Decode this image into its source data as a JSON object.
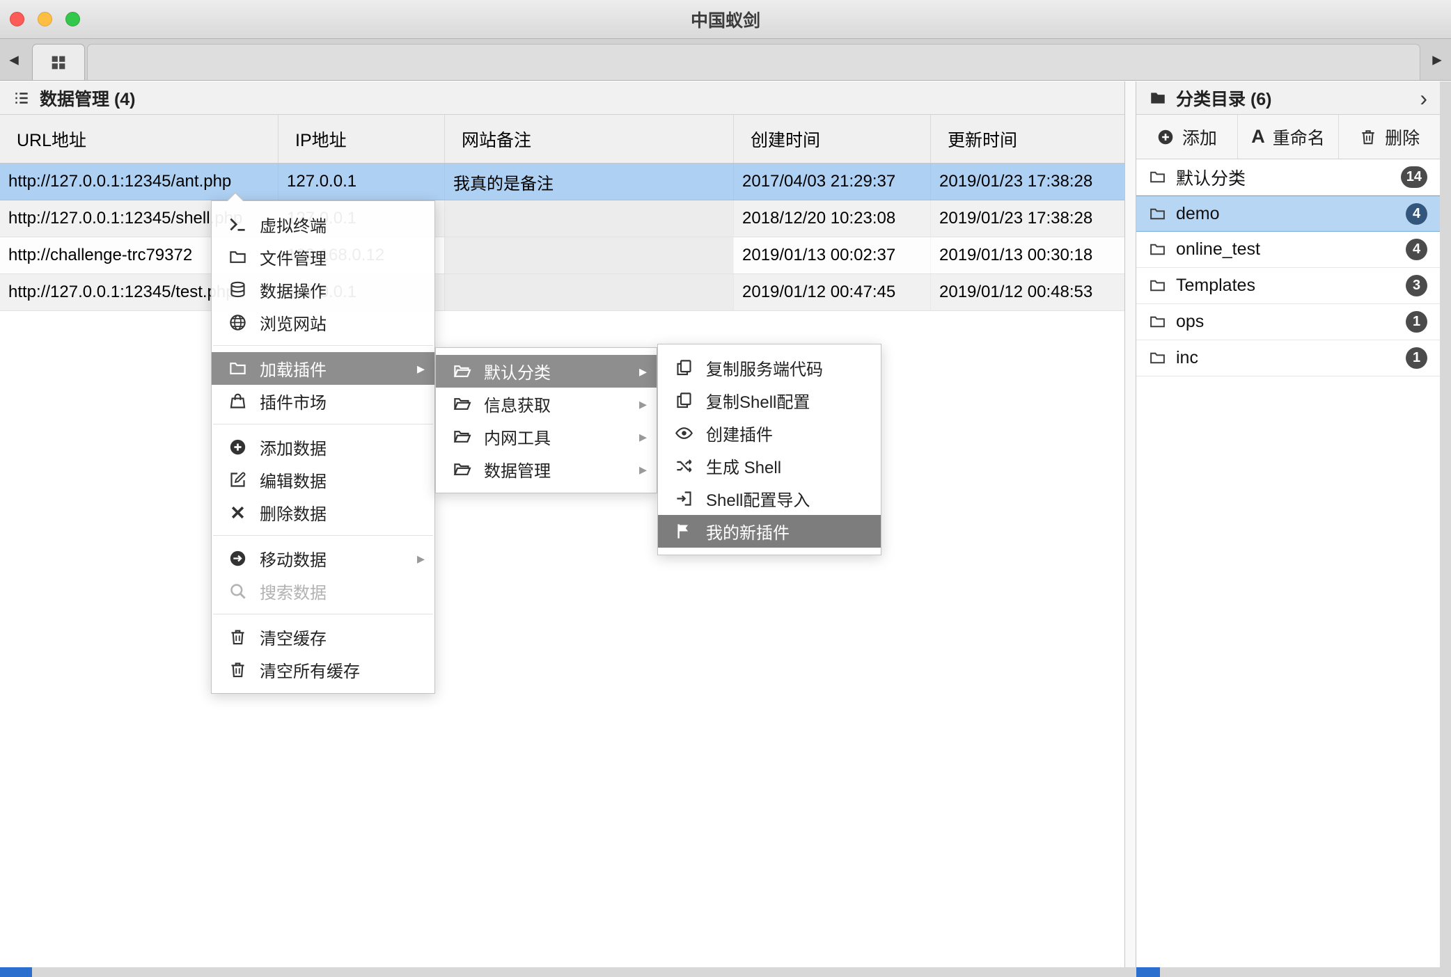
{
  "window": {
    "title": "中国蚁剑"
  },
  "glyphs": {
    "submenu_arrow": "▸",
    "tab_left_arrow": "◂",
    "tab_right_arrow": "▸",
    "panel_chevron": "›",
    "rename_letter": "A"
  },
  "data_panel": {
    "header": {
      "icon": "list-icon",
      "title": "数据管理 (4)"
    },
    "table": {
      "columns": [
        "URL地址",
        "IP地址",
        "网站备注",
        "创建时间",
        "更新时间"
      ],
      "rows": [
        {
          "url": "http://127.0.0.1:12345/ant.php",
          "ip": "127.0.0.1",
          "note": "我真的是备注",
          "created": "2017/04/03 21:29:37",
          "updated": "2019/01/23 17:38:28",
          "selected": true
        },
        {
          "url": "http://127.0.0.1:12345/shell.php",
          "ip": "127.0.0.1",
          "note": "",
          "created": "2018/12/20 10:23:08",
          "updated": "2019/01/23 17:38:28",
          "selected": false
        },
        {
          "url": "http://challenge-trc79372",
          "ip": "192.168.0.12",
          "note": "",
          "created": "2019/01/13 00:02:37",
          "updated": "2019/01/13 00:30:18",
          "selected": false
        },
        {
          "url": "http://127.0.0.1:12345/test.php",
          "ip": "127.0.0.1",
          "note": "",
          "created": "2019/01/12 00:47:45",
          "updated": "2019/01/12 00:48:53",
          "selected": false
        }
      ]
    }
  },
  "context_menu": {
    "items": [
      {
        "icon": "terminal-icon",
        "label": "虚拟终端"
      },
      {
        "icon": "folder-icon",
        "label": "文件管理"
      },
      {
        "icon": "database-icon",
        "label": "数据操作"
      },
      {
        "icon": "globe-icon",
        "label": "浏览网站"
      },
      {
        "icon": "folder-icon",
        "label": "加载插件",
        "submenu": true,
        "highlighted": true
      },
      {
        "icon": "shop-icon",
        "label": "插件市场"
      },
      {
        "icon": "plus-circle-icon",
        "label": "添加数据"
      },
      {
        "icon": "edit-icon",
        "label": "编辑数据"
      },
      {
        "icon": "delete-icon",
        "label": "删除数据"
      },
      {
        "icon": "move-icon",
        "label": "移动数据",
        "submenu": true
      },
      {
        "icon": "search-icon",
        "label": "搜索数据",
        "disabled": true
      },
      {
        "icon": "trash-icon",
        "label": "清空缓存"
      },
      {
        "icon": "trash-icon",
        "label": "清空所有缓存"
      }
    ]
  },
  "plugin_submenu": {
    "items": [
      {
        "icon": "folder-open-icon",
        "label": "默认分类",
        "submenu": true,
        "highlighted": true
      },
      {
        "icon": "folder-open-icon",
        "label": "信息获取",
        "submenu": true
      },
      {
        "icon": "folder-open-icon",
        "label": "内网工具",
        "submenu": true
      },
      {
        "icon": "folder-open-icon",
        "label": "数据管理",
        "submenu": true
      }
    ]
  },
  "plugin_actions_submenu": {
    "items": [
      {
        "icon": "copy-icon",
        "label": "复制服务端代码"
      },
      {
        "icon": "copy-icon",
        "label": "复制Shell配置"
      },
      {
        "icon": "eye-icon",
        "label": "创建插件"
      },
      {
        "icon": "shuffle-icon",
        "label": "生成 Shell"
      },
      {
        "icon": "import-icon",
        "label": "Shell配置导入"
      },
      {
        "icon": "flag-icon",
        "label": "我的新插件",
        "highlighted": true
      }
    ]
  },
  "category_panel": {
    "header": {
      "icon": "folder-icon",
      "title": "分类目录 (6)"
    },
    "toolbar": [
      {
        "icon": "plus-circle-icon",
        "label": "添加"
      },
      {
        "icon": "letter-a-icon",
        "label": "重命名"
      },
      {
        "icon": "trash-icon",
        "label": "删除"
      }
    ],
    "items": [
      {
        "icon": "folder-icon",
        "label": "默认分类",
        "count": "14",
        "selected": false
      },
      {
        "icon": "folder-icon",
        "label": "demo",
        "count": "4",
        "selected": true
      },
      {
        "icon": "folder-icon",
        "label": "online_test",
        "count": "4",
        "selected": false
      },
      {
        "icon": "folder-icon",
        "label": "Templates",
        "count": "3",
        "selected": false
      },
      {
        "icon": "folder-icon",
        "label": "ops",
        "count": "1",
        "selected": false
      },
      {
        "icon": "folder-icon",
        "label": "inc",
        "count": "1",
        "selected": false
      }
    ]
  },
  "colors": {
    "selection_blue": "#aed0f2",
    "category_selected_blue": "#b7d6f4",
    "menu_highlight_gray": "#8e8e8e",
    "menu_highlight_dark_gray": "#7d7d7d",
    "badge_dark": "#4b4b4b",
    "status_blue": "#2a6fce"
  }
}
